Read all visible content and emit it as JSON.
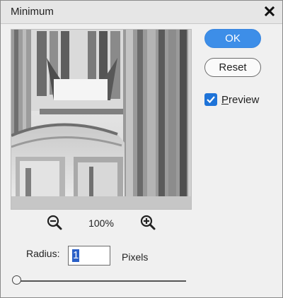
{
  "window": {
    "title": "Minimum",
    "close_icon": "close-icon"
  },
  "preview": {
    "zoom_level": "100%",
    "zoom_out_icon": "zoom-out-icon",
    "zoom_in_icon": "zoom-in-icon"
  },
  "buttons": {
    "ok_label": "OK",
    "reset_label": "Reset"
  },
  "options": {
    "preview_label": "Preview",
    "preview_checked": true
  },
  "radius": {
    "label": "Radius:",
    "value": "1",
    "units": "Pixels",
    "slider_fraction": 0.0
  },
  "colors": {
    "accent": "#3d8ee8",
    "checkbox": "#1e73d8",
    "selection": "#2a5fc7"
  }
}
